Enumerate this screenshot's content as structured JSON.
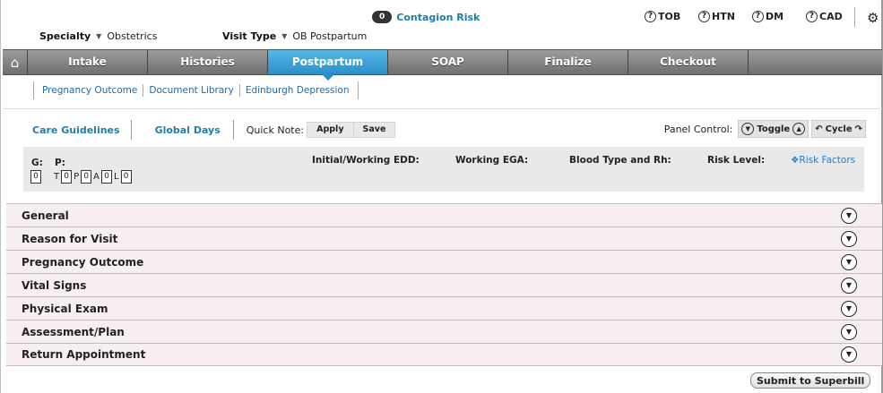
{
  "header": {
    "contagion_count": "0",
    "contagion_label": "Contagion Risk",
    "flags": [
      "TOB",
      "HTN",
      "DM",
      "CAD"
    ],
    "specialty_label": "Specialty",
    "specialty_value": "Obstetrics",
    "visit_type_label": "Visit Type",
    "visit_type_value": "OB Postpartum"
  },
  "tabs": [
    "Intake",
    "Histories",
    "Postpartum",
    "SOAP",
    "Finalize",
    "Checkout"
  ],
  "subnav": [
    "Pregnancy Outcome",
    "Document Library",
    "Edinburgh Depression"
  ],
  "toolbar": {
    "care_guidelines": "Care Guidelines",
    "global_days": "Global Days",
    "quick_note": "Quick Note:",
    "apply": "Apply",
    "save": "Save",
    "panel_control": "Panel Control:",
    "toggle": "Toggle",
    "cycle": "Cycle"
  },
  "summary": {
    "g": "G:",
    "p": "P:",
    "edd": "Initial/Working EDD:",
    "ega": "Working EGA:",
    "blood": "Blood Type and Rh:",
    "risk": "Risk Level:",
    "risk_factors": "Risk Factors",
    "g_value": "0",
    "t_label": "T",
    "t_value": "0",
    "p_label": "P",
    "p_value": "0",
    "a_label": "A",
    "a_value": "0",
    "l_label": "L",
    "l_value": "0"
  },
  "sections": [
    "General",
    "Reason for Visit",
    "Pregnancy Outcome",
    "Vital Signs",
    "Physical Exam",
    "Assessment/Plan",
    "Return Appointment"
  ],
  "submit_label": "Submit to Superbill"
}
